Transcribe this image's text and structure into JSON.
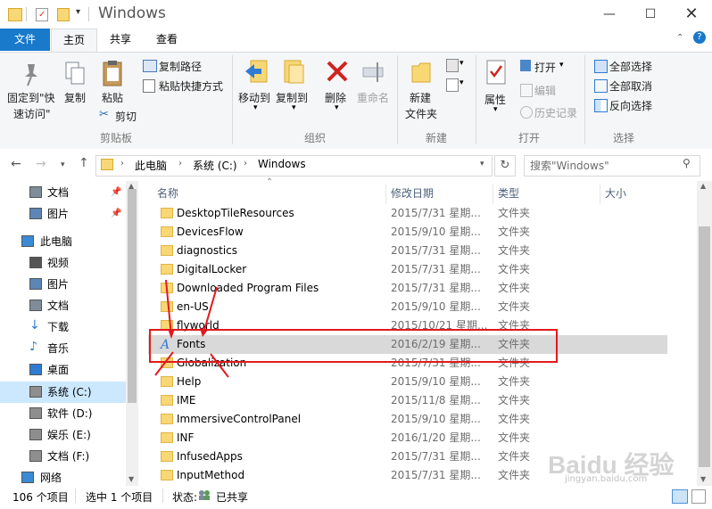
{
  "window": {
    "title": "Windows"
  },
  "tabs": {
    "file": "文件",
    "home": "主页",
    "share": "共享",
    "view": "查看"
  },
  "ribbon": {
    "pin_label": "固定到\"快",
    "pin_label2": "速访问\"",
    "copy": "复制",
    "paste": "粘贴",
    "copy_path": "复制路径",
    "paste_shortcut": "粘贴快捷方式",
    "cut": "剪切",
    "group_clipboard": "剪贴板",
    "move_to": "移动到",
    "copy_to": "复制到",
    "delete": "删除",
    "rename": "重命名",
    "group_organize": "组织",
    "new_folder_1": "新建",
    "new_folder_2": "文件夹",
    "group_new": "新建",
    "properties": "属性",
    "open": "打开",
    "edit": "编辑",
    "history": "历史记录",
    "group_open": "打开",
    "select_all": "全部选择",
    "select_none": "全部取消",
    "invert_select": "反向选择",
    "group_select": "选择"
  },
  "address": {
    "crumbs": [
      "此电脑",
      "系统 (C:)",
      "Windows"
    ],
    "search_placeholder": "搜索\"Windows\""
  },
  "nav": [
    {
      "label": "文档",
      "icon": "document-icon",
      "pinned": true
    },
    {
      "label": "图片",
      "icon": "picture-icon",
      "pinned": true
    },
    {
      "label": "此电脑",
      "icon": "computer-icon"
    },
    {
      "label": "视频",
      "icon": "video-icon"
    },
    {
      "label": "图片",
      "icon": "picture-icon"
    },
    {
      "label": "文档",
      "icon": "document-icon"
    },
    {
      "label": "下载",
      "icon": "download-icon"
    },
    {
      "label": "音乐",
      "icon": "music-icon"
    },
    {
      "label": "桌面",
      "icon": "desktop-icon"
    },
    {
      "label": "系统 (C:)",
      "icon": "drive-icon"
    },
    {
      "label": "软件 (D:)",
      "icon": "drive-icon"
    },
    {
      "label": "娱乐 (E:)",
      "icon": "drive-icon"
    },
    {
      "label": "文档 (F:)",
      "icon": "drive-icon"
    },
    {
      "label": "网络",
      "icon": "network-icon"
    }
  ],
  "columns": {
    "name": "名称",
    "date": "修改日期",
    "type": "类型",
    "size": "大小"
  },
  "files": [
    {
      "name": "DesktopTileResources",
      "date": "2015/7/31 星期...",
      "type": "文件夹"
    },
    {
      "name": "DevicesFlow",
      "date": "2015/9/10 星期...",
      "type": "文件夹"
    },
    {
      "name": "diagnostics",
      "date": "2015/7/31 星期...",
      "type": "文件夹"
    },
    {
      "name": "DigitalLocker",
      "date": "2015/7/31 星期...",
      "type": "文件夹"
    },
    {
      "name": "Downloaded Program Files",
      "date": "2015/7/31 星期...",
      "type": "文件夹"
    },
    {
      "name": "en-US",
      "date": "2015/9/10 星期...",
      "type": "文件夹"
    },
    {
      "name": "flyworld",
      "date": "2015/10/21 星期...",
      "type": "文件夹"
    },
    {
      "name": "Fonts",
      "date": "2016/2/19 星期...",
      "type": "文件夹"
    },
    {
      "name": "Globalization",
      "date": "2015/7/31 星期...",
      "type": "文件夹"
    },
    {
      "name": "Help",
      "date": "2015/9/10 星期...",
      "type": "文件夹"
    },
    {
      "name": "IME",
      "date": "2015/11/8 星期...",
      "type": "文件夹"
    },
    {
      "name": "ImmersiveControlPanel",
      "date": "2015/9/10 星期...",
      "type": "文件夹"
    },
    {
      "name": "INF",
      "date": "2016/1/20 星期...",
      "type": "文件夹"
    },
    {
      "name": "InfusedApps",
      "date": "2015/7/31 星期...",
      "type": "文件夹"
    },
    {
      "name": "InputMethod",
      "date": "2015/7/31 星期...",
      "type": "文件夹"
    }
  ],
  "selected_index": 7,
  "status": {
    "count": "106 个项目",
    "selected": "选中 1 个项目",
    "state_label": "状态:",
    "state_value": "已共享"
  },
  "watermark": {
    "brand": "Baidu 经验",
    "url": "jingyan.baidu.com"
  },
  "colors": {
    "accent": "#1979ca",
    "selected_row": "#d9d9d9",
    "annotation": "#e3191c"
  }
}
